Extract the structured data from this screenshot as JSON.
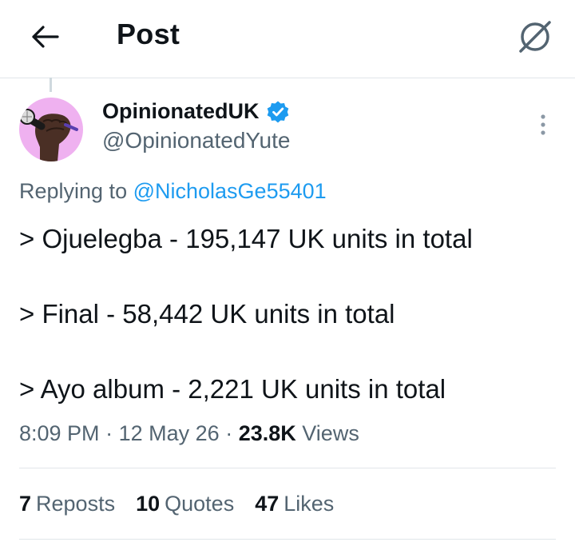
{
  "header": {
    "title": "Post",
    "back_icon": "arrow-left-icon",
    "right_icon": "grok-icon"
  },
  "tweet": {
    "display_name": "OpinionatedUK",
    "handle": "@OpinionatedYute",
    "verified": true,
    "verified_color": "#1d9bf0",
    "replying_prefix": "Replying to ",
    "replying_to": "@NicholasGe55401",
    "lines": [
      "> Ojuelegba - 195,147 UK units in total",
      "> Final - 58,442 UK units in total",
      "> Ayo album - 2,221 UK units in total"
    ],
    "time": "8:09 PM",
    "date": "12 May 26",
    "separator": "·",
    "views_count": "23.8K",
    "views_label": "Views"
  },
  "stats": [
    {
      "count": "7",
      "label": "Reposts"
    },
    {
      "count": "10",
      "label": "Quotes"
    },
    {
      "count": "47",
      "label": "Likes"
    }
  ],
  "colors": {
    "accent": "#1d9bf0",
    "secondary_text": "#536471",
    "primary_text": "#0f1419",
    "avatar_bg": "#efb1f0"
  }
}
